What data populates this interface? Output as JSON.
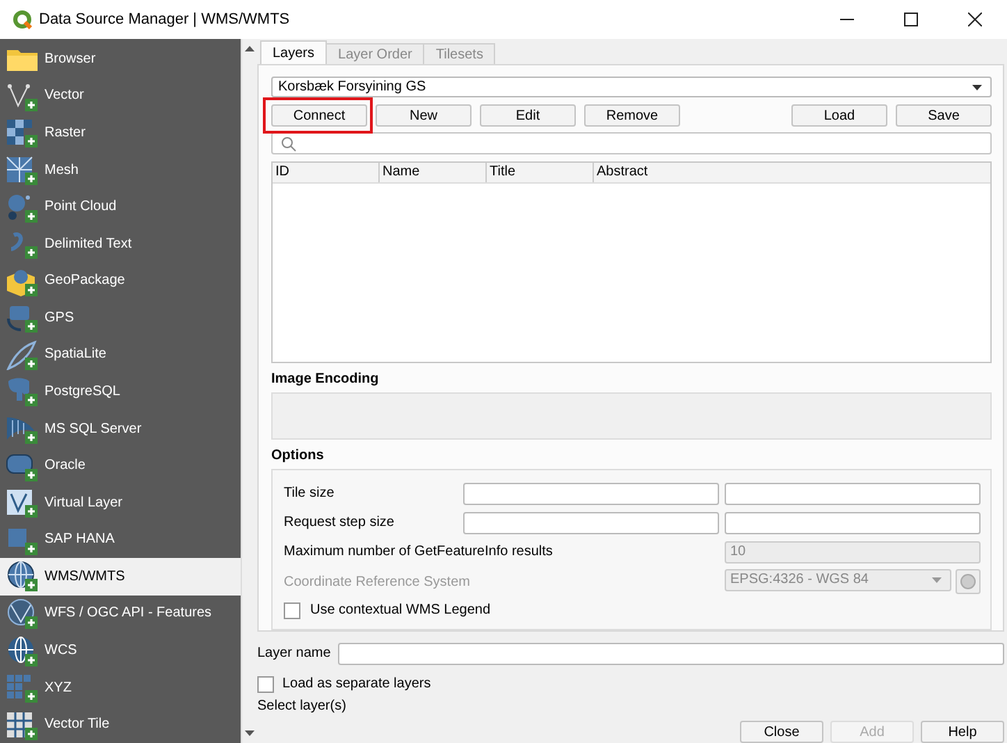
{
  "window": {
    "title": "Data Source Manager | WMS/WMTS"
  },
  "sidebar": {
    "items": [
      {
        "label": "Browser",
        "selected": false
      },
      {
        "label": "Vector",
        "selected": false
      },
      {
        "label": "Raster",
        "selected": false
      },
      {
        "label": "Mesh",
        "selected": false
      },
      {
        "label": "Point Cloud",
        "selected": false
      },
      {
        "label": "Delimited Text",
        "selected": false
      },
      {
        "label": "GeoPackage",
        "selected": false
      },
      {
        "label": "GPS",
        "selected": false
      },
      {
        "label": "SpatiaLite",
        "selected": false
      },
      {
        "label": "PostgreSQL",
        "selected": false
      },
      {
        "label": "MS SQL Server",
        "selected": false
      },
      {
        "label": "Oracle",
        "selected": false
      },
      {
        "label": "Virtual Layer",
        "selected": false
      },
      {
        "label": "SAP HANA",
        "selected": false
      },
      {
        "label": "WMS/WMTS",
        "selected": true
      },
      {
        "label": "WFS / OGC API - Features",
        "selected": false
      },
      {
        "label": "WCS",
        "selected": false
      },
      {
        "label": "XYZ",
        "selected": false
      },
      {
        "label": "Vector Tile",
        "selected": false
      }
    ]
  },
  "tabs": [
    {
      "label": "Layers",
      "selected": true
    },
    {
      "label": "Layer Order",
      "selected": false
    },
    {
      "label": "Tilesets",
      "selected": false
    }
  ],
  "connection": {
    "value": "Korsbæk Forsyining GS"
  },
  "connection_buttons": [
    {
      "label": "Connect",
      "highlighted": true
    },
    {
      "label": "New",
      "highlighted": false
    },
    {
      "label": "Edit",
      "highlighted": false
    },
    {
      "label": "Remove",
      "highlighted": false
    }
  ],
  "file_buttons": [
    {
      "label": "Load"
    },
    {
      "label": "Save"
    }
  ],
  "table": {
    "columns": [
      "ID",
      "Name",
      "Title",
      "Abstract"
    ]
  },
  "image_encoding": {
    "title": "Image Encoding"
  },
  "options": {
    "title": "Options",
    "rows": [
      {
        "kind": "pair",
        "label": "Tile size",
        "disabled": false
      },
      {
        "kind": "pair",
        "label": "Request step size",
        "disabled": false
      },
      {
        "kind": "single",
        "label": "Maximum number of GetFeatureInfo results",
        "value": "10",
        "disabled": false,
        "field_disabled": true
      },
      {
        "kind": "combo",
        "label": "Coordinate Reference System",
        "value": "EPSG:4326 - WGS 84",
        "disabled": true,
        "field_disabled": true
      },
      {
        "kind": "check",
        "label": "Use contextual WMS Legend",
        "checked": false
      }
    ]
  },
  "layer_name": {
    "label": "Layer name"
  },
  "separate_layers": {
    "label": "Load as separate layers",
    "checked": false
  },
  "status": "Select layer(s)",
  "dialog_buttons": [
    {
      "label": "Close",
      "disabled": false
    },
    {
      "label": "Add",
      "disabled": true
    },
    {
      "label": "Help",
      "disabled": false
    }
  ]
}
